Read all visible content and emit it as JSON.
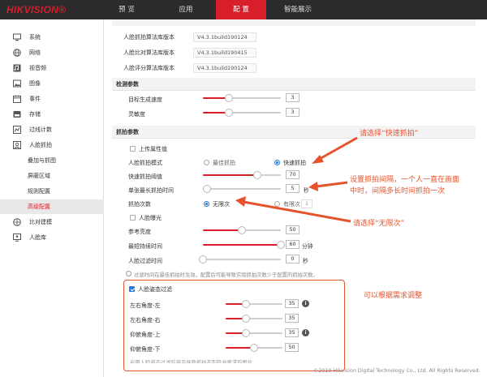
{
  "header": {
    "logo": "HIKVISION®",
    "tabs": [
      "预 览",
      "应用",
      "配 置",
      "智能展示"
    ],
    "active_tab": 2
  },
  "sidebar": {
    "items": [
      {
        "label": "系统",
        "icon": "computer-icon"
      },
      {
        "label": "网络",
        "icon": "globe-icon"
      },
      {
        "label": "视音频",
        "icon": "audio-video-icon"
      },
      {
        "label": "图像",
        "icon": "image-icon"
      },
      {
        "label": "事件",
        "icon": "calendar-icon"
      },
      {
        "label": "存储",
        "icon": "storage-icon"
      },
      {
        "label": "过线计数",
        "icon": "line-count-icon"
      },
      {
        "label": "人脸抓拍",
        "icon": "face-user-icon"
      },
      {
        "label": "叠加与抓图",
        "icon": ""
      },
      {
        "label": "屏蔽区域",
        "icon": ""
      },
      {
        "label": "规则配置",
        "icon": ""
      },
      {
        "label": "高级配置",
        "icon": ""
      },
      {
        "label": "比对建模",
        "icon": "compare-icon"
      },
      {
        "label": "人脸库",
        "icon": "face-library-icon"
      }
    ],
    "active_index": 11
  },
  "versions": [
    {
      "label": "人脸抓拍算法库版本",
      "value": "V4.3.1build190124"
    },
    {
      "label": "人脸比对算法库版本",
      "value": "V4.3.1build190415"
    },
    {
      "label": "人脸评分算法库版本",
      "value": "V4.3.1build190124"
    }
  ],
  "detection": {
    "header": "检测参数",
    "rows": [
      {
        "label": "目标生成速度",
        "value": "3",
        "fraction": 0.33
      },
      {
        "label": "灵敏度",
        "value": "3",
        "fraction": 0.33
      }
    ]
  },
  "capture": {
    "header": "抓拍参数",
    "upload_attr": {
      "label": "上传属性值",
      "checked": false
    },
    "mode": {
      "label": "人脸抓拍模式",
      "options": [
        "最佳抓拍",
        "快速抓拍"
      ],
      "selected": 1
    },
    "threshold": {
      "label": "快速抓拍阈值",
      "value": "70",
      "fraction": 0.7
    },
    "interval": {
      "label": "单张最长抓拍时间",
      "value": "5",
      "unit": "秒",
      "fraction": 0.05
    },
    "count": {
      "label": "抓拍次数",
      "options": [
        "无限次",
        "有限次"
      ],
      "selected": 0,
      "limited_value": "1"
    },
    "exposure": {
      "label": "人脸曝光",
      "checked": false
    },
    "ref_brightness": {
      "label": "参考亮度",
      "value": "50",
      "fraction": 0.5
    },
    "min_duration": {
      "label": "最短持续时间",
      "value": "60",
      "unit": "分钟",
      "fraction": 1.0
    },
    "filter_time": {
      "label": "人脸过滤时间",
      "value": "0",
      "unit": "秒",
      "fraction": 0.0
    },
    "note": "过滤时间在最佳抓拍时生效。配置后可能导致实际抓拍次数少于配置的抓拍次数。"
  },
  "pose": {
    "filter": {
      "label": "人脸姿态过滤",
      "checked": true
    },
    "rows": [
      {
        "label": "左右角度-左",
        "value": "35",
        "fraction": 0.35,
        "info": true
      },
      {
        "label": "左右角度-右",
        "value": "35",
        "fraction": 0.35,
        "info": false
      },
      {
        "label": "仰俯角度-上",
        "value": "35",
        "fraction": 0.35,
        "info": true
      },
      {
        "label": "仰俯角度-下",
        "value": "50",
        "fraction": 0.5,
        "info": false
      }
    ],
    "partial_note": "启用人脸姿态过滤后将会导致抓拍不到符合要求的图片"
  },
  "annotations": {
    "fast_capture": "请选择“快速抓拍”",
    "interval_1": "设置抓拍间隔，一个人一直在画面",
    "interval_2": "中时，间隔多长时间抓拍一次",
    "unlimited": "请选择“无限次”",
    "adjust": "可以根据需求调整"
  },
  "footer": "©2019 Hikvision Digital Technology Co., Ltd. All Rights Reserved.",
  "colors": {
    "brand_red": "#d81e2a",
    "annotation_orange": "#e5532b",
    "topbar": "#2b2b2b",
    "radio_blue": "#2477d6"
  }
}
